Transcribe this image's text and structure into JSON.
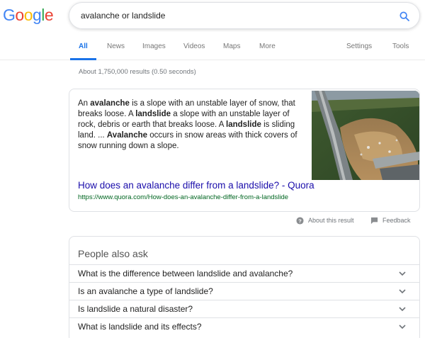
{
  "logo": {
    "letters": [
      "G",
      "o",
      "o",
      "g",
      "l",
      "e"
    ]
  },
  "search": {
    "query": "avalanche or landslide"
  },
  "tabs": [
    {
      "label": "All"
    },
    {
      "label": "News"
    },
    {
      "label": "Images"
    },
    {
      "label": "Videos"
    },
    {
      "label": "Maps"
    },
    {
      "label": "More"
    },
    {
      "label": "Settings"
    },
    {
      "label": "Tools"
    }
  ],
  "result_stats": "About 1,750,000 results (0.50 seconds)",
  "featured_snippet": {
    "text_parts": [
      {
        "t": "An ",
        "b": false
      },
      {
        "t": "avalanche",
        "b": true
      },
      {
        "t": " is a slope with an unstable layer of snow, that breaks loose. A ",
        "b": false
      },
      {
        "t": "landslide",
        "b": true
      },
      {
        "t": " a slope with an unstable layer of rock, debris or earth that breaks loose. A ",
        "b": false
      },
      {
        "t": "landslide",
        "b": true
      },
      {
        "t": " is sliding land. ... ",
        "b": false
      },
      {
        "t": "Avalanche",
        "b": true
      },
      {
        "t": " occurs in snow areas with thick covers of snow running down a slope.",
        "b": false
      }
    ],
    "title": "How does an avalanche differ from a landslide? - Quora",
    "url": "https://www.quora.com/How-does-an-avalanche-differ-from-a-landslide"
  },
  "feedback_row": {
    "about": "About this result",
    "feedback": "Feedback"
  },
  "people_also_ask": {
    "heading": "People also ask",
    "questions": [
      "What is the difference between landslide and avalanche?",
      "Is an avalanche a type of landslide?",
      "Is landslide a natural disaster?",
      "What is landslide and its effects?"
    ]
  },
  "colors": {
    "logo": [
      "#4285f4",
      "#ea4335",
      "#fbbc05",
      "#4285f4",
      "#34a853",
      "#ea4335"
    ],
    "accent": "#1a73e8",
    "link": "#1a0dab",
    "url": "#006621"
  },
  "icons": {
    "search": "search-icon",
    "about": "help-circle-icon",
    "feedback": "feedback-flag-icon",
    "expand": "chevron-down-icon"
  }
}
